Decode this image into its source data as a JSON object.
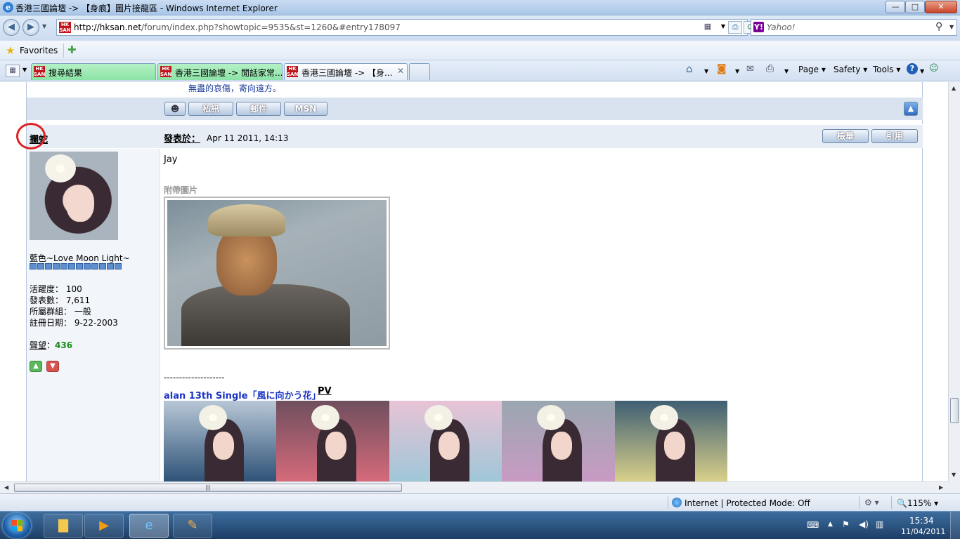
{
  "window": {
    "title": "香港三國論壇 -> 【身痕】圖片接龍區 - Windows Internet Explorer",
    "minimize_glyph": "—",
    "maximize_glyph": "□",
    "close_glyph": "✕"
  },
  "address_bar": {
    "url_domain": "http://hksan.net",
    "url_path": "/forum/index.php?showtopic=9535&st=1260&#entry178097"
  },
  "search": {
    "placeholder": "Yahoo!",
    "provider_glyph": "Y!"
  },
  "favorites": {
    "label": "Favorites"
  },
  "tabs": [
    {
      "label": "搜尋結果",
      "active": false
    },
    {
      "label": "香港三國論壇 -> 閒話家常...",
      "active": false
    },
    {
      "label": "香港三國論壇 -> 【身...",
      "active": true
    }
  ],
  "command_bar": {
    "page": "Page ▾",
    "safety": "Safety ▾",
    "tools": "Tools ▾",
    "help": "?"
  },
  "post_prev": {
    "signature_tail": "無盡的哀傷，寄向遠方。",
    "buttons": {
      "pm": "私訊",
      "email": "郵件",
      "msn": "MSN"
    }
  },
  "post": {
    "author": "攔蛇",
    "posted_label": "發表於：",
    "date": "Apr 11 2011, 14:13",
    "report_label": "檢舉",
    "quote_label": "引用",
    "text": "Jay",
    "attachment_label": "附帶圖片",
    "signature_line": "--------------------",
    "signature_title": "alan 13th Single「風に向かう花」",
    "signature_pv": "PV"
  },
  "user": {
    "title": "藍色~Love Moon Light~",
    "rank_pips": 12,
    "activity": "活躍度： 100",
    "posts": "發表數： 7,611",
    "group": "所屬群組： 一般",
    "registered": "註冊日期： 9-22-2003",
    "reputation_label": "聲望",
    "reputation_sep": "：",
    "reputation_value": "436"
  },
  "status_bar": {
    "zone": "Internet | Protected Mode: Off",
    "zoom": "🔍115% ▾"
  },
  "taskbar": {
    "time": "15:34",
    "date": "11/04/2011"
  },
  "colors": {
    "link_blue": "#1a35c4",
    "reputation_green": "#1a8c1a",
    "annotation_red": "#e02020"
  }
}
